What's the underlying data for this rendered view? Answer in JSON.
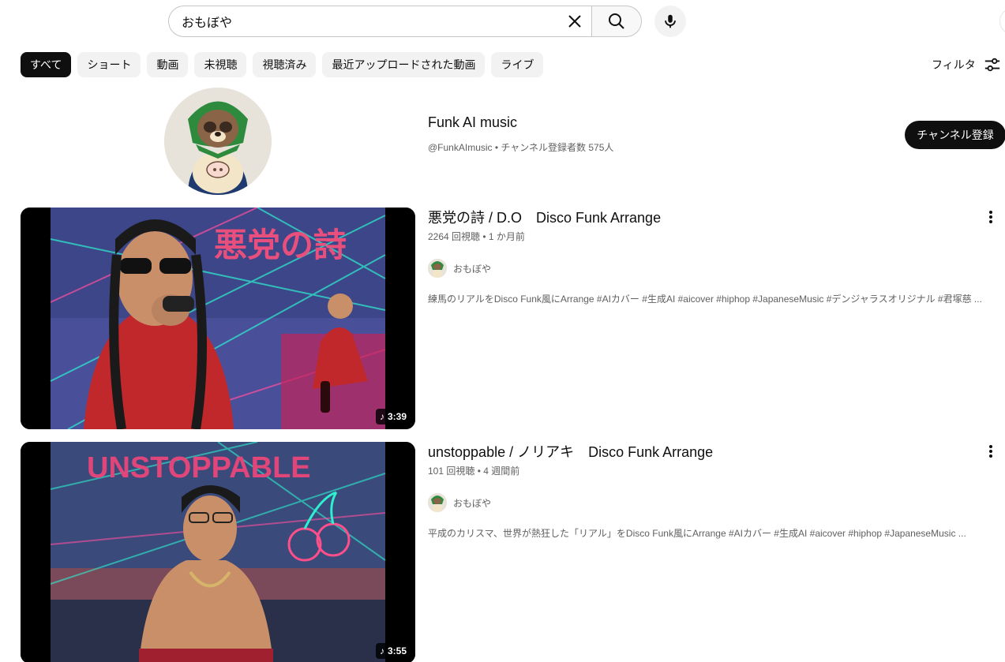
{
  "search": {
    "query": "おもぼや"
  },
  "chips": [
    "すべて",
    "ショート",
    "動画",
    "未視聴",
    "視聴済み",
    "最近アップロードされた動画",
    "ライブ"
  ],
  "filter_label": "フィルタ",
  "channel": {
    "name": "Funk AI music",
    "meta": "@FunkAImusic • チャンネル登録者数 575人",
    "subscribe_label": "チャンネル登録"
  },
  "videos": [
    {
      "title": "悪党の詩 / D.O　Disco Funk Arrange",
      "meta": "2264 回視聴 • 1 か月前",
      "channel": "おもぼや",
      "description": "練馬のリアルをDisco Funk風にArrange #AIカバー #生成AI #aicover #hiphop #JapaneseMusic #デンジャラスオリジナル #君塚慈 ...",
      "duration": "3:39",
      "thumb_text": "悪党の詩"
    },
    {
      "title": "unstoppable / ノリアキ　Disco Funk Arrange",
      "meta": "101 回視聴 • 4 週間前",
      "channel": "おもぼや",
      "description": "平成のカリスマ、世界が熱狂した「リアル」をDisco Funk風にArrange #AIカバー #生成AI #aicover #hiphop #JapaneseMusic ...",
      "duration": "3:55",
      "thumb_text": "UNSTOPPABLE"
    }
  ],
  "colors": {
    "accent": "#0f0f0f",
    "secondary_text": "#606060",
    "chip_bg": "#f2f2f2"
  }
}
